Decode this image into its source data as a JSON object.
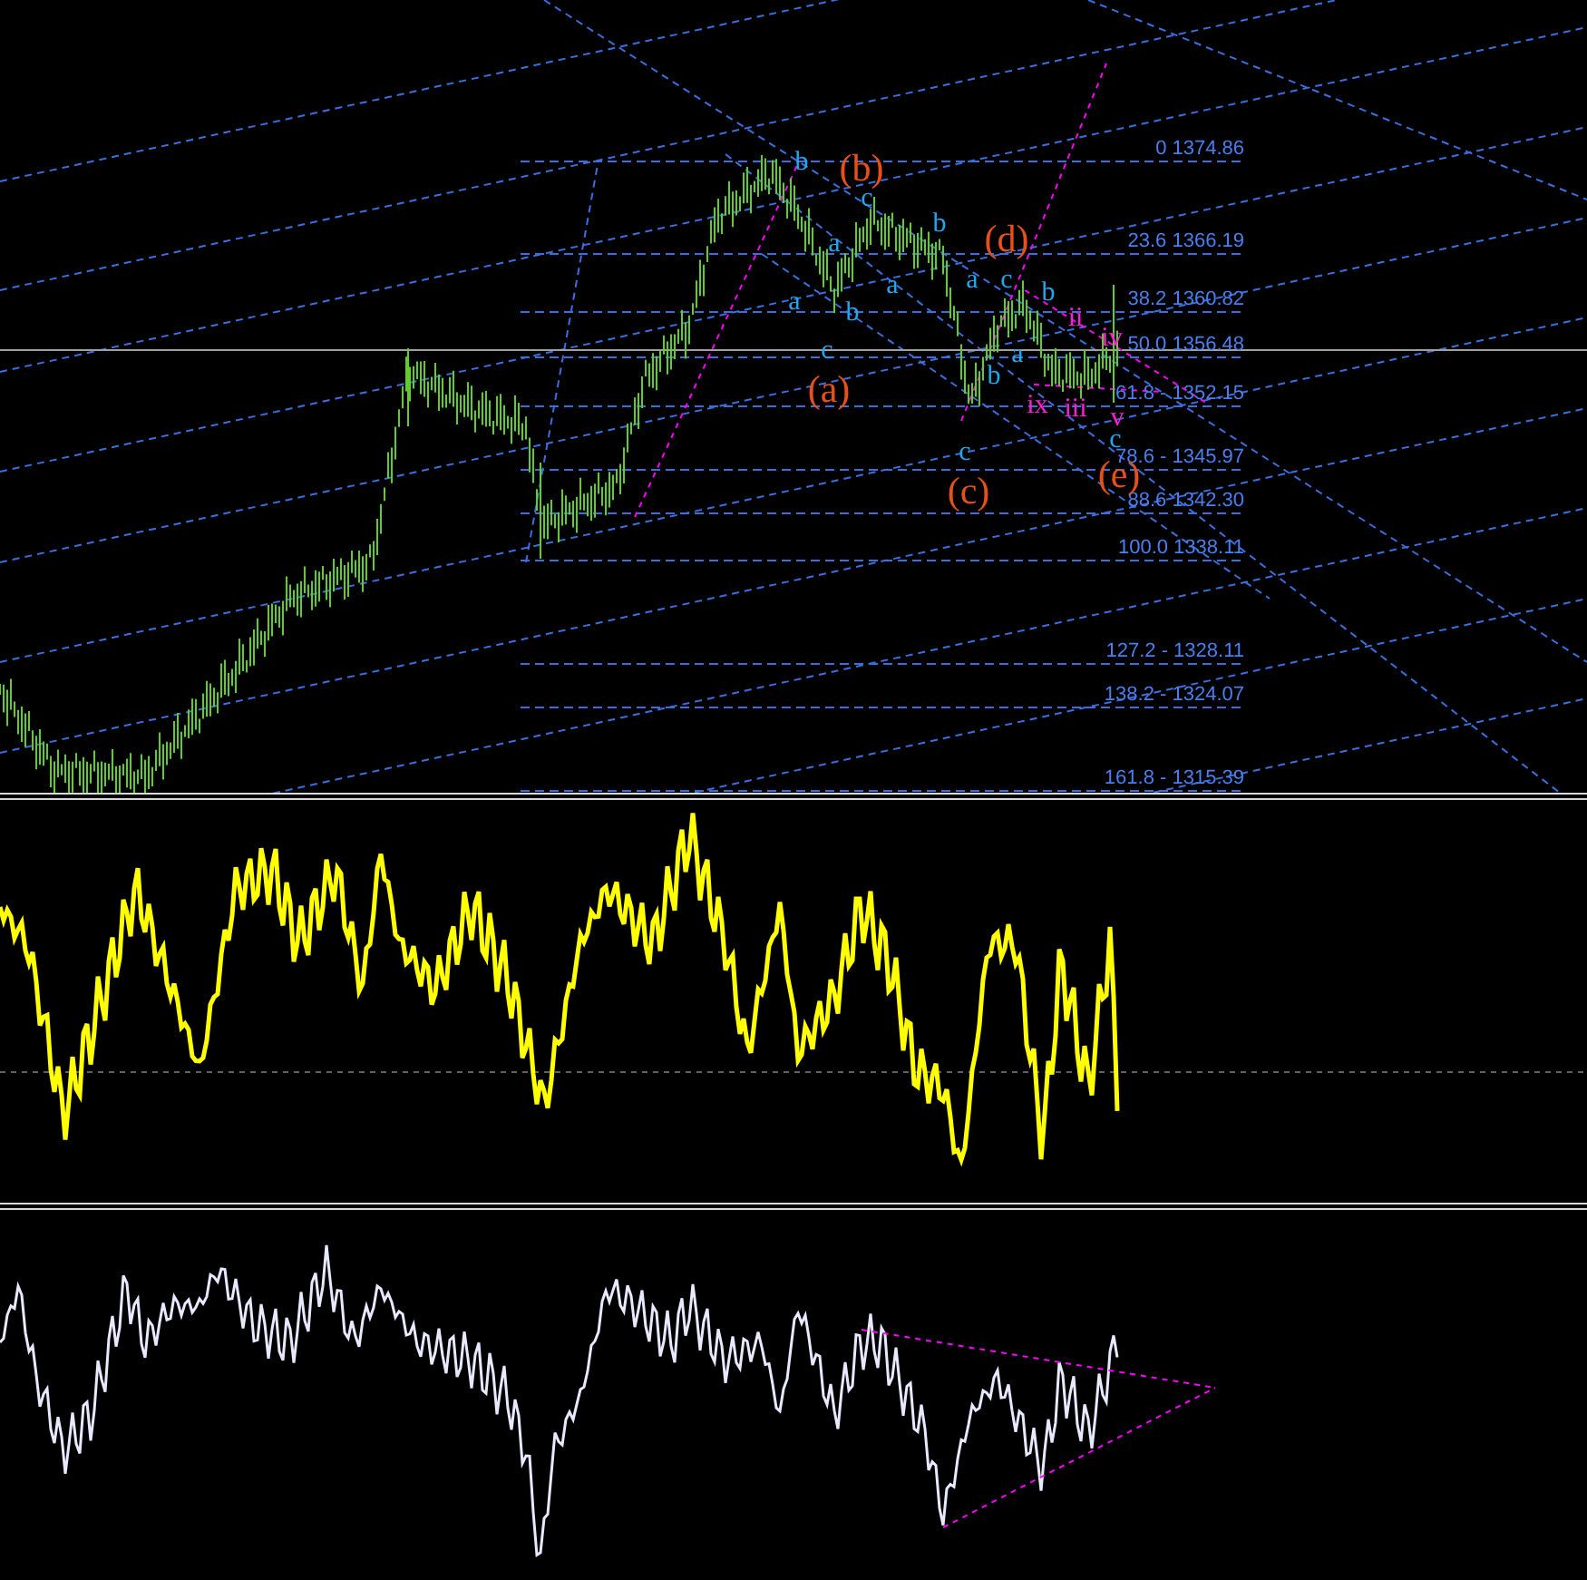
{
  "price_chart": {
    "fib_levels": [
      {
        "label": "0 1374.86"
      },
      {
        "label": "23.6 1366.19"
      },
      {
        "label": "38.2 1360.82"
      },
      {
        "label": "50.0 1356.48"
      },
      {
        "label": "61.8 - 1352.15"
      },
      {
        "label": "78.6 - 1345.97"
      },
      {
        "label": "88.6 1342.30"
      },
      {
        "label": "100.0 1338.11"
      },
      {
        "label": "127.2 - 1328.11"
      },
      {
        "label": "138.2 - 1324.07"
      },
      {
        "label": "161.8 - 1315.39"
      }
    ],
    "wave_labels": [
      {
        "text": "b",
        "kind": "minor"
      },
      {
        "text": "(b)",
        "kind": "major"
      },
      {
        "text": "c",
        "kind": "minor"
      },
      {
        "text": "a",
        "kind": "minor"
      },
      {
        "text": "a",
        "kind": "minor"
      },
      {
        "text": "b",
        "kind": "minor"
      },
      {
        "text": "a",
        "kind": "minor"
      },
      {
        "text": "b",
        "kind": "minor"
      },
      {
        "text": "c",
        "kind": "minor"
      },
      {
        "text": "(a)",
        "kind": "major"
      },
      {
        "text": "a",
        "kind": "minor"
      },
      {
        "text": "(d)",
        "kind": "major"
      },
      {
        "text": "c",
        "kind": "minor"
      },
      {
        "text": "b",
        "kind": "minor"
      },
      {
        "text": "ii",
        "kind": "sub"
      },
      {
        "text": "iv",
        "kind": "sub"
      },
      {
        "text": "b",
        "kind": "minor"
      },
      {
        "text": "a",
        "kind": "minor"
      },
      {
        "text": "ix",
        "kind": "sub"
      },
      {
        "text": "iii",
        "kind": "sub"
      },
      {
        "text": "v",
        "kind": "sub"
      },
      {
        "text": "c",
        "kind": "minor"
      },
      {
        "text": "(c)",
        "kind": "major"
      },
      {
        "text": "c",
        "kind": "minor"
      },
      {
        "text": "(e)",
        "kind": "major"
      }
    ]
  }
}
